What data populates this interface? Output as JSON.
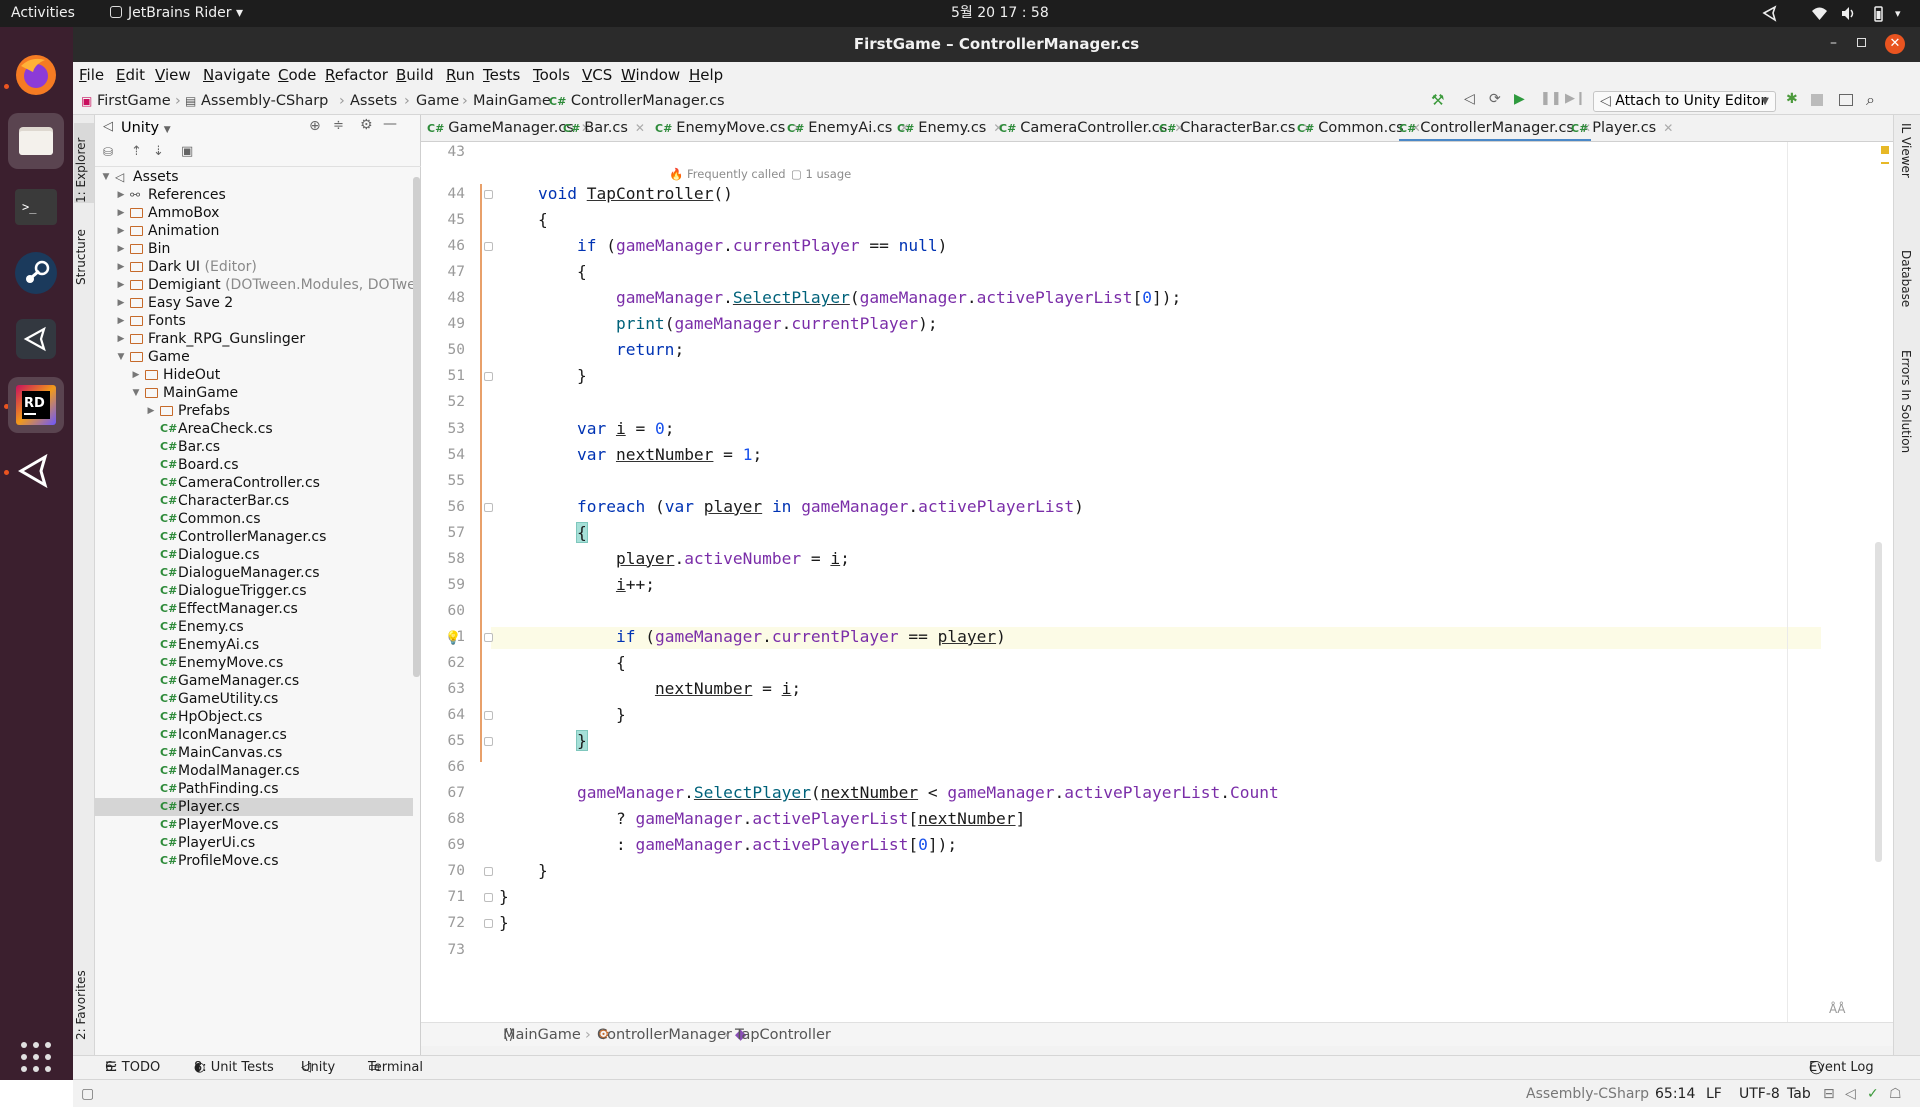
{
  "topbar": {
    "activities": "Activities",
    "app_name": "JetBrains Rider",
    "clock": "5월 20  17 : 58"
  },
  "dock": {
    "items": [
      "firefox-icon",
      "files-icon",
      "terminal-icon",
      "steam-icon",
      "unity-hub-icon",
      "rider-icon",
      "unity-icon"
    ],
    "rider_label": "RD",
    "apps_grid": "show-applications-icon"
  },
  "window": {
    "title": "FirstGame – ControllerManager.cs"
  },
  "menu": [
    "File",
    "Edit",
    "View",
    "Navigate",
    "Code",
    "Refactor",
    "Build",
    "Run",
    "Tests",
    "Tools",
    "VCS",
    "Window",
    "Help"
  ],
  "navbar": {
    "crumbs": [
      "FirstGame",
      "Assembly-CSharp",
      "Assets",
      "Game",
      "MainGame",
      "ControllerManager.cs"
    ],
    "run_config": "Attach to Unity Editor"
  },
  "left_tabs": {
    "explorer": "1: Explorer",
    "structure": "Structure",
    "favorites": "2: Favorites"
  },
  "explorer": {
    "scope": "Unity",
    "tree": [
      {
        "label": "Assets",
        "extra": "",
        "kind": "root",
        "depth": 0,
        "open": true
      },
      {
        "label": "References",
        "extra": "",
        "kind": "ref",
        "depth": 1,
        "open": false
      },
      {
        "label": "AmmoBox",
        "extra": "",
        "kind": "folder",
        "depth": 1,
        "open": false
      },
      {
        "label": "Animation",
        "extra": "",
        "kind": "folder",
        "depth": 1,
        "open": false
      },
      {
        "label": "Bin",
        "extra": "",
        "kind": "folder",
        "depth": 1,
        "open": false
      },
      {
        "label": "Dark UI",
        "extra": "(Editor)",
        "kind": "folder",
        "depth": 1,
        "open": false
      },
      {
        "label": "Demigiant",
        "extra": "(DOTween.Modules, DOTwe",
        "kind": "folder",
        "depth": 1,
        "open": false
      },
      {
        "label": "Easy Save 2",
        "extra": "",
        "kind": "folder",
        "depth": 1,
        "open": false
      },
      {
        "label": "Fonts",
        "extra": "",
        "kind": "folder",
        "depth": 1,
        "open": false
      },
      {
        "label": "Frank_RPG_Gunslinger",
        "extra": "",
        "kind": "folder",
        "depth": 1,
        "open": false
      },
      {
        "label": "Game",
        "extra": "",
        "kind": "folder",
        "depth": 1,
        "open": true
      },
      {
        "label": "HideOut",
        "extra": "",
        "kind": "folder",
        "depth": 2,
        "open": false
      },
      {
        "label": "MainGame",
        "extra": "",
        "kind": "folder",
        "depth": 2,
        "open": true
      },
      {
        "label": "Prefabs",
        "extra": "",
        "kind": "folder",
        "depth": 3,
        "open": false
      },
      {
        "label": "AreaCheck.cs",
        "extra": "",
        "kind": "cs",
        "depth": 3
      },
      {
        "label": "Bar.cs",
        "extra": "",
        "kind": "cs",
        "depth": 3
      },
      {
        "label": "Board.cs",
        "extra": "",
        "kind": "cs",
        "depth": 3
      },
      {
        "label": "CameraController.cs",
        "extra": "",
        "kind": "cs",
        "depth": 3
      },
      {
        "label": "CharacterBar.cs",
        "extra": "",
        "kind": "cs",
        "depth": 3
      },
      {
        "label": "Common.cs",
        "extra": "",
        "kind": "cs",
        "depth": 3
      },
      {
        "label": "ControllerManager.cs",
        "extra": "",
        "kind": "cs",
        "depth": 3
      },
      {
        "label": "Dialogue.cs",
        "extra": "",
        "kind": "cs",
        "depth": 3
      },
      {
        "label": "DialogueManager.cs",
        "extra": "",
        "kind": "cs",
        "depth": 3
      },
      {
        "label": "DialogueTrigger.cs",
        "extra": "",
        "kind": "cs",
        "depth": 3
      },
      {
        "label": "EffectManager.cs",
        "extra": "",
        "kind": "cs",
        "depth": 3
      },
      {
        "label": "Enemy.cs",
        "extra": "",
        "kind": "cs",
        "depth": 3
      },
      {
        "label": "EnemyAi.cs",
        "extra": "",
        "kind": "cs",
        "depth": 3
      },
      {
        "label": "EnemyMove.cs",
        "extra": "",
        "kind": "cs",
        "depth": 3
      },
      {
        "label": "GameManager.cs",
        "extra": "",
        "kind": "cs",
        "depth": 3
      },
      {
        "label": "GameUtility.cs",
        "extra": "",
        "kind": "cs",
        "depth": 3
      },
      {
        "label": "HpObject.cs",
        "extra": "",
        "kind": "cs",
        "depth": 3
      },
      {
        "label": "IconManager.cs",
        "extra": "",
        "kind": "cs",
        "depth": 3
      },
      {
        "label": "MainCanvas.cs",
        "extra": "",
        "kind": "cs",
        "depth": 3
      },
      {
        "label": "ModalManager.cs",
        "extra": "",
        "kind": "cs",
        "depth": 3
      },
      {
        "label": "PathFinding.cs",
        "extra": "",
        "kind": "cs",
        "depth": 3
      },
      {
        "label": "Player.cs",
        "extra": "",
        "kind": "cs",
        "depth": 3,
        "selected": true
      },
      {
        "label": "PlayerMove.cs",
        "extra": "",
        "kind": "cs",
        "depth": 3
      },
      {
        "label": "PlayerUi.cs",
        "extra": "",
        "kind": "cs",
        "depth": 3
      },
      {
        "label": "ProfileMove.cs",
        "extra": "",
        "kind": "cs",
        "depth": 3
      }
    ]
  },
  "tabs": {
    "prefix": "C#",
    "items": [
      "GameManager.cs",
      "Bar.cs",
      "EnemyMove.cs",
      "EnemyAi.cs",
      "Enemy.cs",
      "CameraController.cs",
      "CharacterBar.cs",
      "Common.cs",
      "ControllerManager.cs",
      "Player.cs"
    ],
    "active": "ControllerManager.cs"
  },
  "editor": {
    "first_line_number": 43,
    "hint_frequently": "Frequently called",
    "hint_usage": "1 usage",
    "lines": [
      "",
      "    void TapController()",
      "    {",
      "        if (gameManager.currentPlayer == null)",
      "        {",
      "            gameManager.SelectPlayer(gameManager.activePlayerList[0]);",
      "            print(gameManager.currentPlayer);",
      "            return;",
      "        }",
      "",
      "        var i = 0;",
      "        var nextNumber = 1;",
      "",
      "        foreach (var player in gameManager.activePlayerList)",
      "        {",
      "            player.activeNumber = i;",
      "            i++;",
      "",
      "            if (gameManager.currentPlayer == player)",
      "            {",
      "                nextNumber = i;",
      "            }",
      "        }",
      "",
      "        gameManager.SelectPlayer(nextNumber < gameManager.activePlayerList.Count",
      "            ? gameManager.activePlayerList[nextNumber]",
      "            : gameManager.activePlayerList[0]);",
      "    }",
      "}",
      "}",
      ""
    ],
    "caret_line": 65
  },
  "right_tabs": {
    "il_viewer": "IL Viewer",
    "database": "Database",
    "errors": "Errors In Solution"
  },
  "editor_breadcrumbs": [
    "MainGame",
    "ControllerManager",
    "TapController"
  ],
  "tool_windows": {
    "todo": "6: TODO",
    "unit_tests": "8: Unit Tests",
    "unity": "Unity",
    "terminal": "Terminal",
    "event_log": "Event Log"
  },
  "status": {
    "project": "Assembly-CSharp",
    "position": "65:14",
    "line_sep": "LF",
    "encoding": "UTF-8",
    "indent": "Tab"
  },
  "colors": {
    "accent": "#4a88c7",
    "dock_bg": "#3b1f2e",
    "csharp_green": "#2e8b3a",
    "folder_orange": "#c66a2a",
    "ubuntu_orange": "#e95420"
  }
}
